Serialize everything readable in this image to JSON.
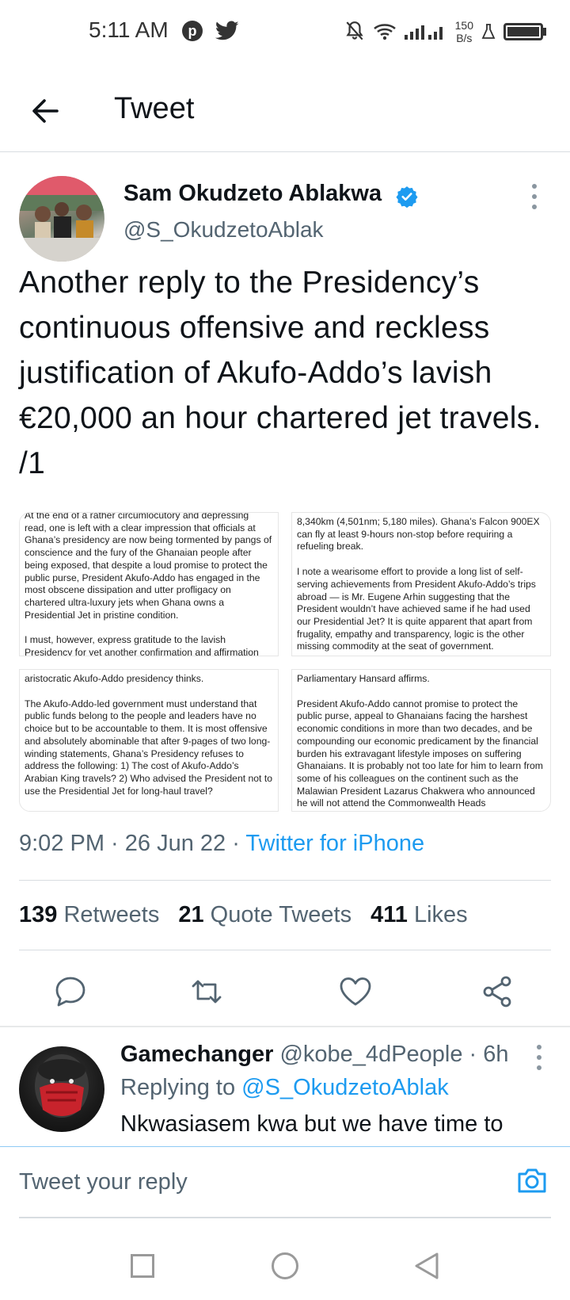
{
  "status_bar": {
    "time": "5:11 AM",
    "speed_top": "150",
    "speed_bottom": "B/s"
  },
  "header": {
    "title": "Tweet"
  },
  "tweet": {
    "author_name": "Sam Okudzeto Ablakwa",
    "author_handle": "@S_OkudzetoAblak",
    "text": "Another reply to the Presidency’s continuous offensive and reckless justification of Akufo-Addo’s lavish €20,000 an hour chartered jet travels. /1",
    "images": [
      {
        "paragraphs": [
          "At the end of a rather circumlocutory and depressing read, one is left with a clear impression that officials at Ghana’s presidency are now being tormented by pangs of conscience and the fury of the Ghanaian people after being exposed, that despite a loud promise to protect the public purse, President Akufo-Addo has engaged in the most obscene dissipation and utter profligacy on chartered ultra-luxury jets when Ghana owns a Presidential Jet in pristine condition.",
          "I must, however, express gratitude to the lavish Presidency for yet another confirmation and affirmation"
        ]
      },
      {
        "paragraphs": [
          "8,340km (4,501nm; 5,180 miles). Ghana’s Falcon 900EX can fly at least 9-hours non-stop before requiring a refueling break.",
          "I note a wearisome effort to provide a long list of self-serving achievements from President Akufo-Addo’s trips abroad — is Mr. Eugene Arhin suggesting that the President wouldn’t have achieved same if he had used our Presidential Jet? It is quite apparent that apart from frugality, empathy and transparency, logic is the other missing commodity at the seat of government."
        ]
      },
      {
        "paragraphs": [
          "aristocratic Akufo-Addo presidency thinks.",
          "The Akufo-Addo-led government must understand that public funds belong to the people and leaders have no choice but to be accountable to them. It is most offensive and absolutely abominable that after 9-pages of two long-winding statements, Ghana’s Presidency refuses to address the following: 1) The cost of Akufo-Addo’s Arabian King travels? 2) Who advised the President not to use the Presidential Jet for long-haul travel?"
        ]
      },
      {
        "paragraphs": [
          "Parliamentary Hansard affirms.",
          "President Akufo-Addo cannot promise to protect the public purse, appeal to Ghanaians facing the harshest economic conditions in more than two decades, and be compounding our economic predicament by the financial burden his extravagant lifestyle imposes on suffering Ghanaians. It is probably not too late for him to learn from some of his colleagues on the continent such as the Malawian President Lazarus Chakwera who announced he will not attend the Commonwealth Heads"
        ]
      }
    ],
    "time": "9:02 PM",
    "date": "26 Jun 22",
    "source": "Twitter for iPhone",
    "retweets_count": "139",
    "retweets_label": "Retweets",
    "quotes_count": "21",
    "quotes_label": "Quote Tweets",
    "likes_count": "411",
    "likes_label": "Likes"
  },
  "reply": {
    "name": "Gamechanger",
    "handle": "@kobe_4dPeople",
    "age": "6h",
    "replying_to_prefix": "Replying to",
    "replying_to_handle": "@S_OkudzetoAblak",
    "text": "Nkwasiasem kwa but we have time to"
  },
  "composer": {
    "placeholder": "Tweet your reply"
  },
  "colors": {
    "accent": "#1d9bf0",
    "secondary_text": "#536471"
  }
}
